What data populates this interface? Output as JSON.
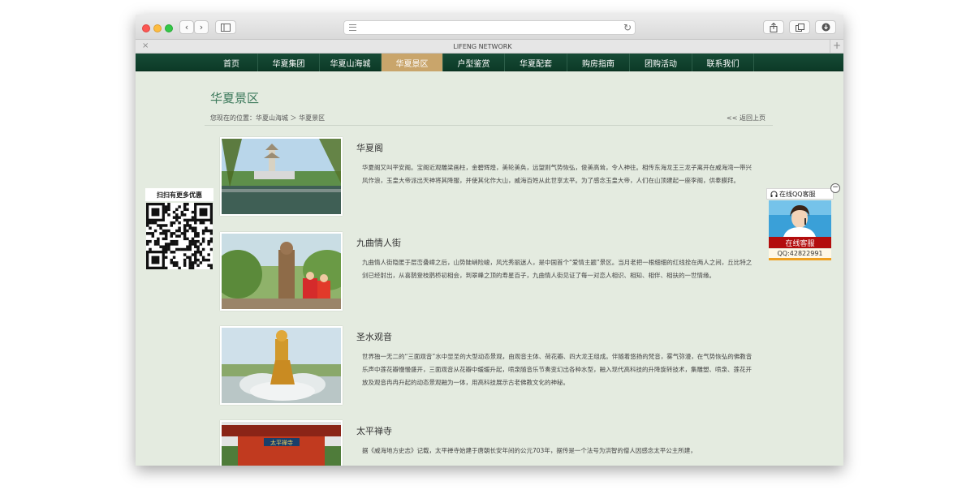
{
  "browser": {
    "tab_title": "LIFENG NETWORK",
    "tab_close": "×",
    "tab_add": "+",
    "back_glyph": "‹",
    "forward_glyph": "›",
    "reload_glyph": "↻"
  },
  "nav": {
    "items": [
      {
        "label": "首页",
        "active": false
      },
      {
        "label": "华夏集团",
        "active": false
      },
      {
        "label": "华夏山海城",
        "active": false
      },
      {
        "label": "华夏景区",
        "active": true
      },
      {
        "label": "户型鉴赏",
        "active": false
      },
      {
        "label": "华夏配套",
        "active": false
      },
      {
        "label": "购房指南",
        "active": false
      },
      {
        "label": "团购活动",
        "active": false
      },
      {
        "label": "联系我们",
        "active": false
      }
    ]
  },
  "page": {
    "title": "华夏景区",
    "breadcrumb": "您现在的位置：华夏山海城 ＞ 华夏景区",
    "back_link": "<< 返回上页"
  },
  "scenic": [
    {
      "title": "华夏阁",
      "desc": "华夏阁又叫平安阁。宝阁近观雕梁画柱，金碧辉煌，美轮美奂，远望则气势恢弘，俊美高耸，令人神往。相传东海龙王三龙子离开在威海湾一带兴风作浪，玉皇大帝派出天神将其降服，并使其化作大山，威海百姓从此世享太平。为了感念玉皇大帝，人们在山顶建起一座李阁，供奉膜拜。"
    },
    {
      "title": "九曲情人街",
      "desc": "九曲情人街隐匿于层峦叠嶂之后，山势陡峭险峻，风光秀丽迷人，是中国首个“爱情主题”景区。当月老把一根细细的红线拴在两人之间，丘比特之剑已经射出，从喜鹊登枝鹊桥初相会，到翠峰之顶的寿星百子，九曲情人街见证了每一对恋人相识、相知、相伴、相扶的一世情缘。"
    },
    {
      "title": "圣水观音",
      "desc": "世界独一无二的“三面观音”水中显圣的大型动态景观，由观音主体、荷花瓣、四大龙王组成。伴随着悠扬的梵音，雾气弥漫，在气势恢弘的佛教音乐声中莲花瓣慢慢盛开，三面观音从花瓣中缓缓升起，喷泉随音乐节奏变幻出各种水型，融入现代高科技的升降旋转技术，集雕塑、喷泉、莲花开放及观音冉冉升起的动态景观融为一体，用高科技展示古老佛教文化的神秘。"
    },
    {
      "title": "太平禅寺",
      "desc": "据《威海地方史志》记载，太平禅寺始建于唐朝长安年间的公元703年，据传是一个法号为洪智的僧人因感念太平公主所建，"
    }
  ],
  "temple_sign": "太平禅寺",
  "qr": {
    "label": "扫扫有更多优惠"
  },
  "qq": {
    "header": "在线QQ客服",
    "online": "在线客服",
    "number": "QQ:42822991",
    "minimize": "−"
  },
  "colors": {
    "nav_bg": "#174b36",
    "nav_active": "#c9a56b",
    "page_bg": "#e4ebe0",
    "title_green": "#3d7a5c",
    "qq_red": "#b30d0d"
  }
}
